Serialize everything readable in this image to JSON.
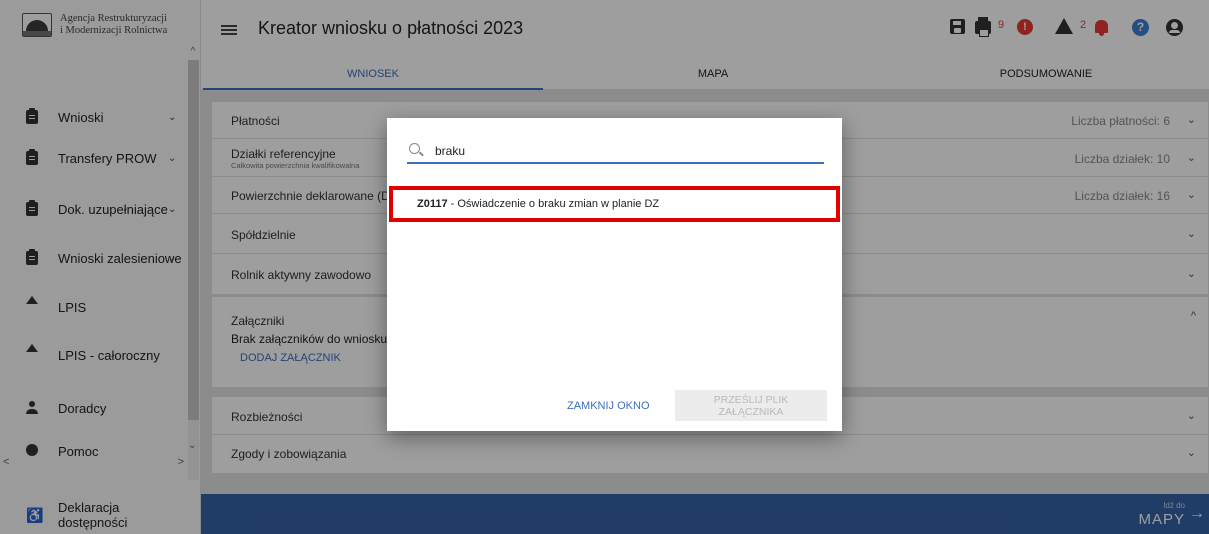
{
  "brand": {
    "line1": "Agencja Restrukturyzacji",
    "line2": "i Modernizacji Rolnictwa"
  },
  "sidebar": {
    "items": [
      {
        "label": "Wnioski",
        "icon": "clipboard-icon",
        "expand": "⌄"
      },
      {
        "label": "Transfery PROW",
        "icon": "clipboard-icon",
        "expand": "⌄"
      },
      {
        "label": "Dok. uzupełniające",
        "icon": "clipboard-icon",
        "expand": "⌄"
      },
      {
        "label": "Wnioski zalesieniowe",
        "icon": "clipboard-icon",
        "expand": "⌄"
      },
      {
        "label": "LPIS",
        "icon": "mountain-icon"
      },
      {
        "label": "LPIS - całoroczny",
        "icon": "mountain-icon"
      },
      {
        "label": "Doradcy",
        "icon": "person-icon"
      },
      {
        "label": "Pomoc",
        "icon": "help-icon"
      }
    ],
    "accessibility": "Deklaracja dostępności"
  },
  "header": {
    "title": "Kreator wniosku o płatności 2023",
    "error_count": "9",
    "warning_count": "2",
    "colors": {
      "error": "#e53935",
      "help": "#3f7fd0"
    }
  },
  "tabs": [
    "WNIOSEK",
    "MAPA",
    "PODSUMOWANIE"
  ],
  "sections": {
    "platnosci": {
      "label": "Płatności",
      "value": "Liczba płatności: 6"
    },
    "dzialki": {
      "label": "Działki referencyjne",
      "sub": "Całkowita powierzchnia kwalifikowalna",
      "value": "Liczba działek: 10"
    },
    "powierzchnie": {
      "label": "Powierzchnie deklarowane (DZ)",
      "value": "Liczba działek: 16"
    },
    "spoldzielnie": {
      "label": "Spółdzielnie"
    },
    "rolnik": {
      "label": "Rolnik aktywny zawodowo"
    },
    "zalaczniki": {
      "label": "Załączniki",
      "empty": "Brak załączników do wniosku",
      "add": "DODAJ ZAŁĄCZNIK"
    },
    "rozbieznosci": {
      "label": "Rozbieżności"
    },
    "zgody": {
      "label": "Zgody i zobowiązania"
    }
  },
  "footer": {
    "small": "Idź do",
    "big": "MAPY",
    "arrow": "→"
  },
  "dialog": {
    "search_value": "braku",
    "result_code": "Z0117",
    "result_text": " - Oświadczenie o braku zmian w planie DZ",
    "close_label": "ZAMKNIJ OKNO",
    "send_label": "PRZEŚLIJ PLIK ZAŁĄCZNIKA",
    "highlight_color": "#e00000"
  }
}
